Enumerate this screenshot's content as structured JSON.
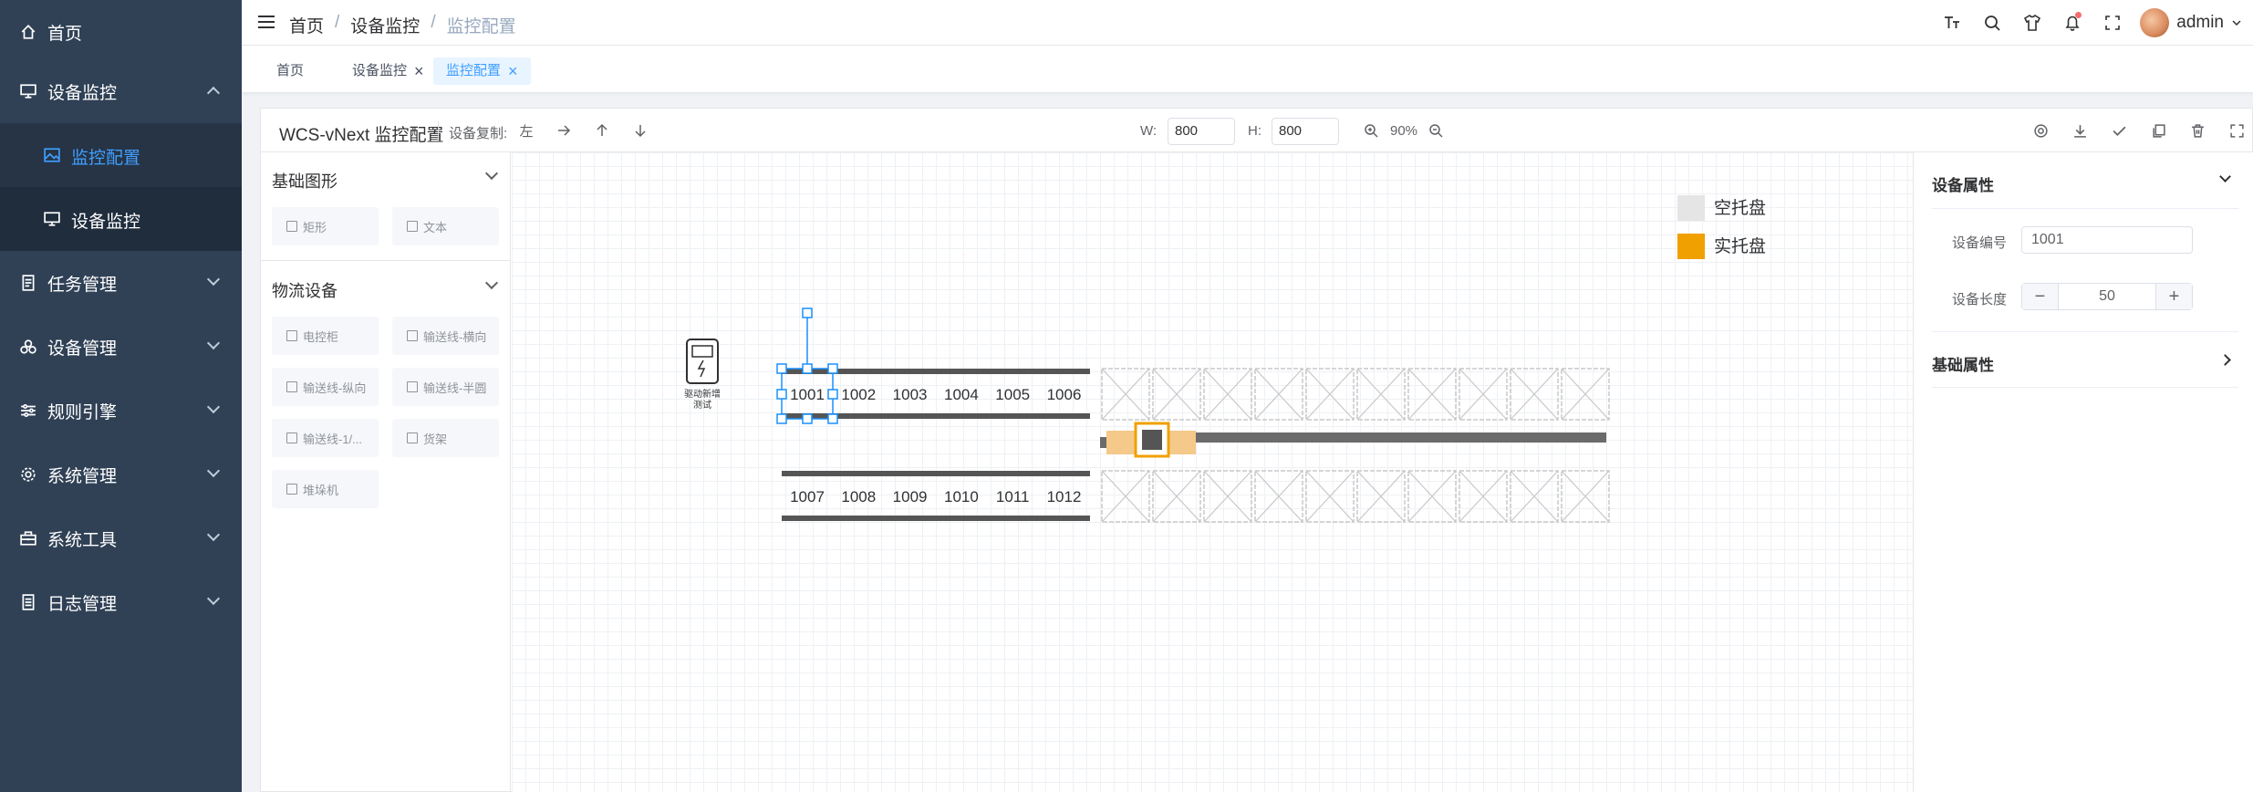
{
  "sidebar": {
    "items": [
      {
        "label": "首页",
        "icon": "home-icon"
      },
      {
        "label": "设备监控",
        "icon": "monitor-icon",
        "expanded": true
      },
      {
        "label": "任务管理",
        "icon": "document-icon"
      },
      {
        "label": "设备管理",
        "icon": "cubes-icon"
      },
      {
        "label": "规则引擎",
        "icon": "sliders-icon"
      },
      {
        "label": "系统管理",
        "icon": "gear-icon"
      },
      {
        "label": "系统工具",
        "icon": "toolbox-icon"
      },
      {
        "label": "日志管理",
        "icon": "log-icon"
      }
    ],
    "subitems": [
      {
        "label": "监控配置",
        "active": true
      },
      {
        "label": "设备监控",
        "active": false
      }
    ]
  },
  "navbar": {
    "breadcrumb": [
      "首页",
      "/",
      "设备监控",
      "/",
      "监控配置"
    ],
    "username": "admin"
  },
  "tags": [
    {
      "label": "首页",
      "closable": false,
      "active": false
    },
    {
      "label": "设备监控",
      "closable": true,
      "active": false
    },
    {
      "label": "监控配置",
      "closable": true,
      "active": true
    }
  ],
  "toolbar": {
    "title": "WCS-vNext 监控配置",
    "copy_label": "设备复制:",
    "copy_left": "左",
    "w_label": "W:",
    "w_value": "800",
    "h_label": "H:",
    "h_value": "800",
    "zoom": "90%"
  },
  "palette": {
    "basic_title": "基础图形",
    "basic_items": [
      "矩形",
      "文本"
    ],
    "logistics_title": "物流设备",
    "logistics_items": [
      "电控柜",
      "输送线-横向",
      "输送线-纵向",
      "输送线-半圆",
      "输送线-1/...",
      "货架",
      "堆垛机"
    ]
  },
  "canvas": {
    "legend": [
      {
        "label": "空托盘",
        "color": "#e5e5e5"
      },
      {
        "label": "实托盘",
        "color": "#f0a000"
      }
    ],
    "cabinet_label_line1": "驱动新增",
    "cabinet_label_line2": "测试",
    "conveyor_top": [
      "1001",
      "1002",
      "1003",
      "1004",
      "1005",
      "1006"
    ],
    "conveyor_bottom": [
      "1007",
      "1008",
      "1009",
      "1010",
      "1011",
      "1012"
    ],
    "rack_columns": 10,
    "stacker_color": "#f0a000"
  },
  "props": {
    "device_section": "设备属性",
    "code_label": "设备编号",
    "code_value": "1001",
    "length_label": "设备长度",
    "length_value": "50",
    "minus": "−",
    "plus": "+",
    "basic_section": "基础属性"
  }
}
